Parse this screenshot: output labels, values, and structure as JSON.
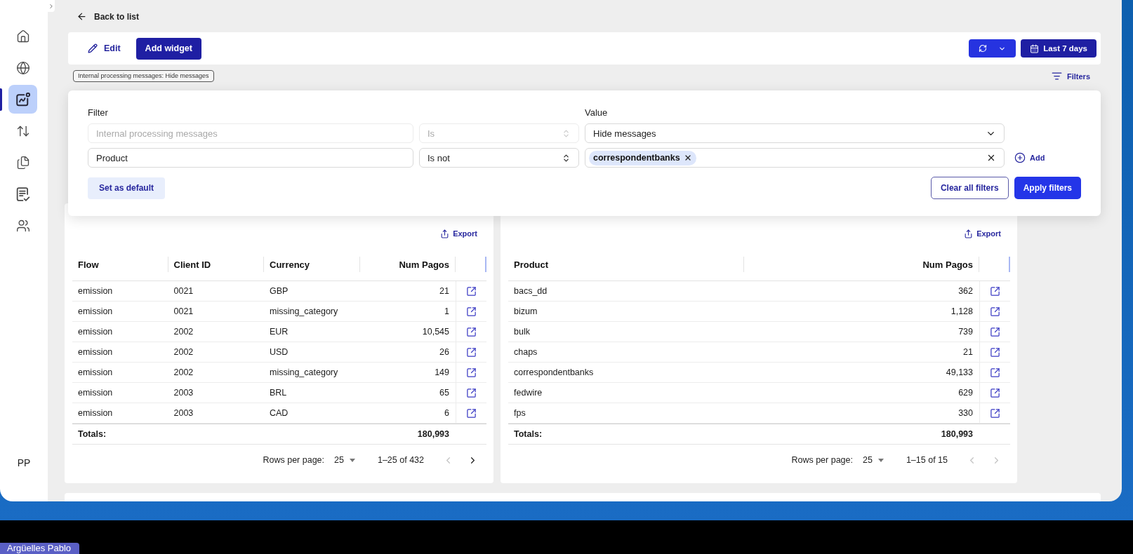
{
  "sidebar": {
    "items": [
      {
        "selected": false
      },
      {
        "selected": false
      },
      {
        "selected": true
      },
      {
        "selected": false
      },
      {
        "selected": false
      },
      {
        "selected": false
      },
      {
        "selected": false
      }
    ],
    "user_initials": "PP"
  },
  "back_link": "Back to list",
  "toolbar": {
    "edit": "Edit",
    "add_widget": "Add widget",
    "date_range": "Last 7 days"
  },
  "applied_filters": [
    "Internal processing messages: Hide messages"
  ],
  "filters_toggle": "Filters",
  "filter_panel": {
    "filter_heading": "Filter",
    "value_heading": "Value",
    "rows": [
      {
        "field": "Internal processing messages",
        "operator": "Is",
        "disabled": true,
        "value": {
          "kind": "select",
          "text": "Hide messages"
        }
      },
      {
        "field": "Product",
        "operator": "Is not",
        "disabled": false,
        "value": {
          "kind": "tags",
          "tags": [
            "correspondentbanks"
          ]
        },
        "add": "Add"
      }
    ],
    "set_default": "Set as default",
    "clear_all": "Clear all filters",
    "apply": "Apply filters"
  },
  "widgets": [
    {
      "export": "Export",
      "columns": [
        {
          "label": "Flow",
          "kind": "text"
        },
        {
          "label": "Client ID",
          "kind": "text"
        },
        {
          "label": "Currency",
          "kind": "text"
        },
        {
          "label": "Num Pagos",
          "kind": "number"
        }
      ],
      "rows": [
        [
          "emission",
          "0021",
          "GBP",
          "21"
        ],
        [
          "emission",
          "0021",
          "missing_category",
          "1"
        ],
        [
          "emission",
          "2002",
          "EUR",
          "10,545"
        ],
        [
          "emission",
          "2002",
          "USD",
          "26"
        ],
        [
          "emission",
          "2002",
          "missing_category",
          "149"
        ],
        [
          "emission",
          "2003",
          "BRL",
          "65"
        ],
        [
          "emission",
          "2003",
          "CAD",
          "6"
        ]
      ],
      "totals_label": "Totals:",
      "total": "180,993",
      "rows_per_page_label": "Rows per page:",
      "rows_per_page": "25",
      "range": "1–25 of 432",
      "prev_disabled": true,
      "next_disabled": false
    },
    {
      "export": "Export",
      "columns": [
        {
          "label": "Product",
          "kind": "text"
        },
        {
          "label": "Num Pagos",
          "kind": "number"
        }
      ],
      "rows": [
        [
          "bacs_dd",
          "362"
        ],
        [
          "bizum",
          "1,128"
        ],
        [
          "bulk",
          "739"
        ],
        [
          "chaps",
          "21"
        ],
        [
          "correspondentbanks",
          "49,133"
        ],
        [
          "fedwire",
          "629"
        ],
        [
          "fps",
          "330"
        ]
      ],
      "totals_label": "Totals:",
      "total": "180,993",
      "rows_per_page_label": "Rows per page:",
      "rows_per_page": "25",
      "range": "1–15 of 15",
      "prev_disabled": true,
      "next_disabled": true
    }
  ],
  "name_tag": "Argüelles Pablo"
}
